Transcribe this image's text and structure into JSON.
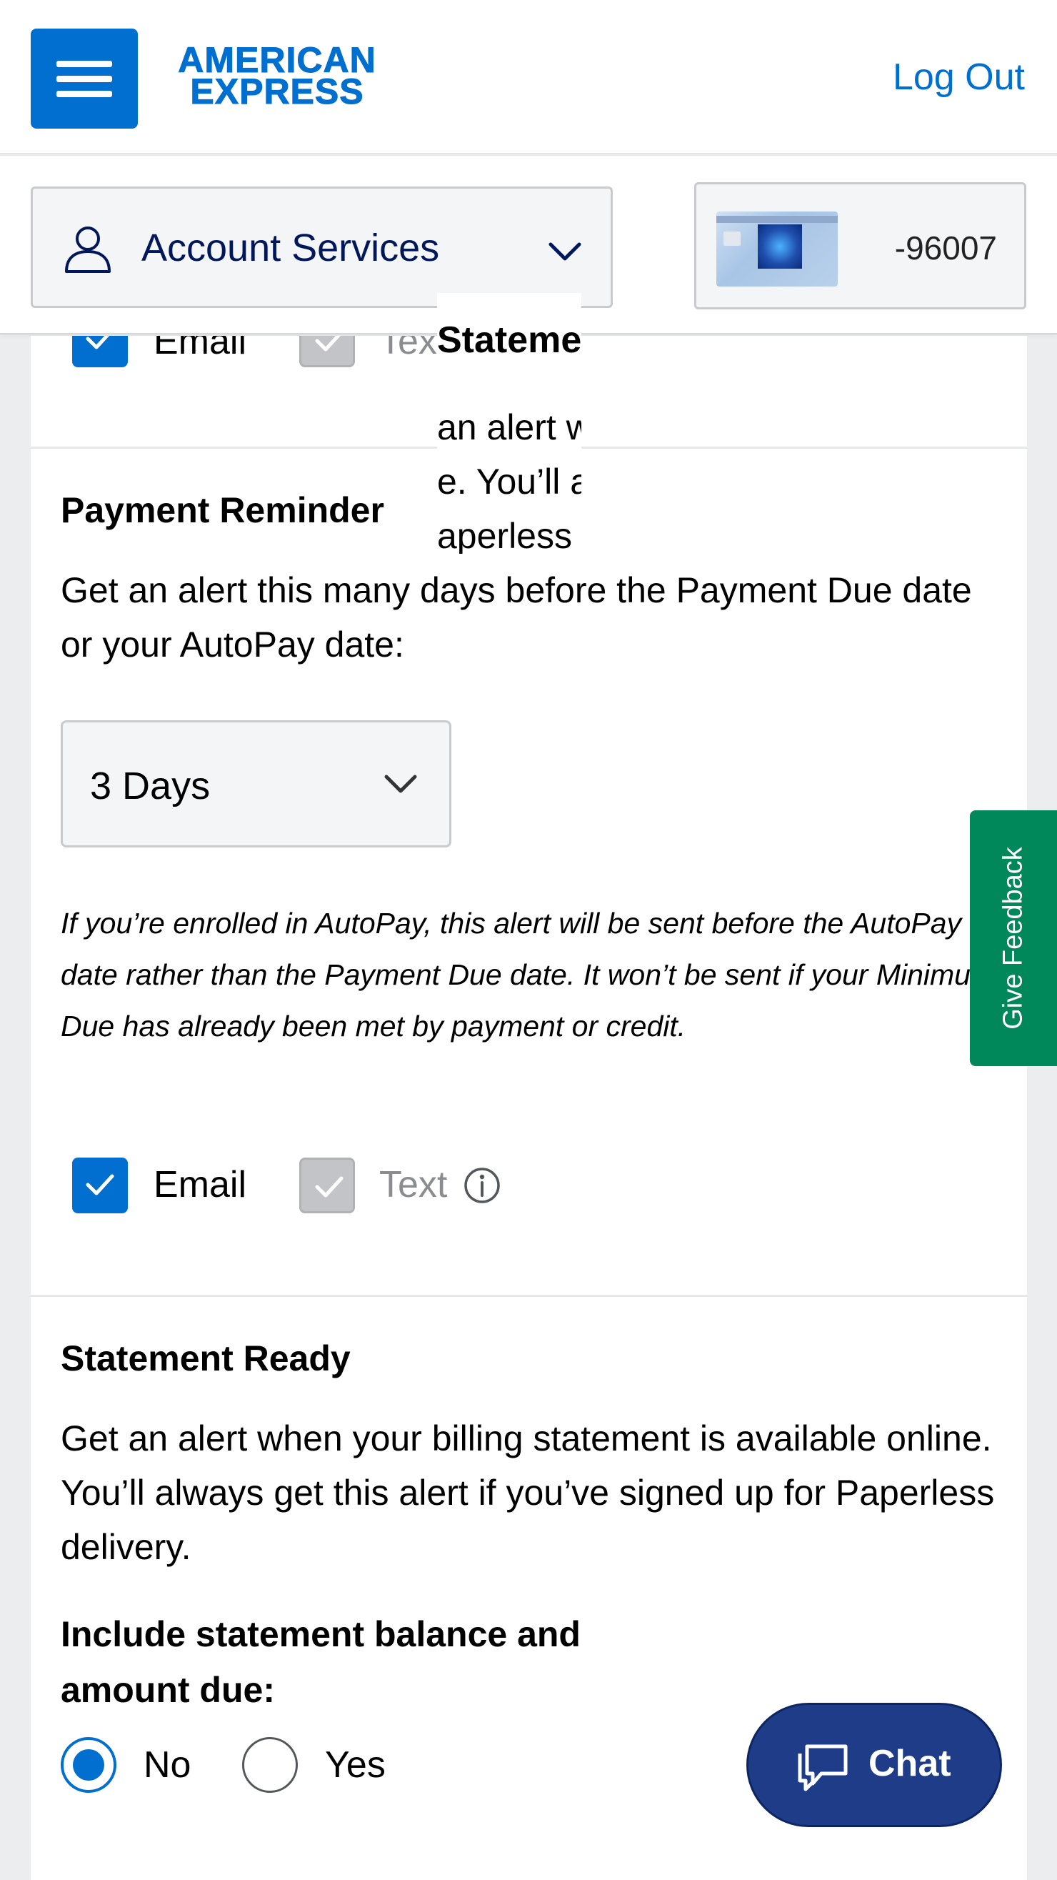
{
  "header": {
    "brand_line1": "AMERICAN",
    "brand_line2": "EXPRESS",
    "logout_label": "Log Out"
  },
  "subheader": {
    "account_services_label": "Account Services",
    "card_number": "-96007"
  },
  "previous_section": {
    "email_label": "Email",
    "text_label": "Text",
    "email_checked": true,
    "text_checked": true
  },
  "ghost_fragment": {
    "heading": "Statement Ready",
    "line1": "an alert w",
    "line2": "e. You’ll a",
    "line3": "aperless"
  },
  "payment_reminder": {
    "heading": "Payment Reminder",
    "description": "Get an alert this many days before the Payment Due date or your AutoPay date:",
    "selected_days": "3 Days",
    "note": "If you’re enrolled in AutoPay, this alert will be sent before the AutoPay date rather than the Payment Due date. It won’t be sent if your Minimum Due has already been met by payment or credit.",
    "email_label": "Email",
    "text_label": "Text",
    "email_checked": true,
    "text_checked": true
  },
  "statement_ready": {
    "heading": "Statement Ready",
    "description": "Get an alert when your billing statement is available online. You’ll always get this alert if you’ve signed up for Paperless delivery.",
    "include_question": "Include statement balance and amount due:",
    "option_no": "No",
    "option_yes": "Yes",
    "selected": "No"
  },
  "floating": {
    "feedback_label": "Give Feedback",
    "chat_label": "Chat"
  },
  "colors": {
    "brand_blue": "#006fcf",
    "navy": "#00175a",
    "feedback_green": "#00875a",
    "chat_blue": "#1f3c88"
  },
  "icons": [
    "menu-icon",
    "person-icon",
    "chevron-down-icon",
    "checkmark-icon",
    "info-icon",
    "chat-icon"
  ]
}
